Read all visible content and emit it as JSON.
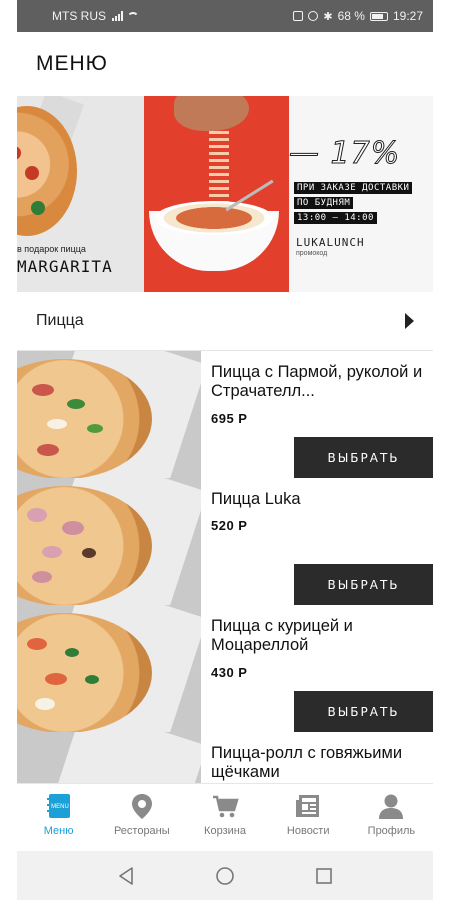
{
  "status_bar": {
    "carrier": "MTS RUS",
    "battery": "68 %",
    "time": "19:27"
  },
  "header": {
    "title": "МЕНЮ"
  },
  "banner": {
    "gift_text": "в подарок пицца",
    "gift_name": "MARGARITA",
    "discount": "— 17%",
    "lines": [
      "ПРИ ЗАКАЗЕ ДОСТАВКИ",
      "ПО БУДНЯМ",
      "13:00 — 14:00"
    ],
    "promo_code": "LUKALUNCH",
    "promo_label": "промокод"
  },
  "category": {
    "label": "Пицца"
  },
  "products": [
    {
      "name": "Пицца с Пармой, руколой и Страчателл...",
      "price": "695 Р",
      "button": "ВЫБРАТЬ"
    },
    {
      "name": "Пицца Luka",
      "price": "520 Р",
      "button": "ВЫБРАТЬ"
    },
    {
      "name": "Пицца с курицей и Моцареллой",
      "price": "430 Р",
      "button": "ВЫБРАТЬ"
    },
    {
      "name": "Пицца-ролл с говяжьими щёчками",
      "price": "",
      "button": ""
    }
  ],
  "tabs": [
    {
      "label": "Меню",
      "icon": "menu-book-icon",
      "active": true
    },
    {
      "label": "Рестораны",
      "icon": "location-pin-icon",
      "active": false
    },
    {
      "label": "Корзина",
      "icon": "cart-icon",
      "active": false
    },
    {
      "label": "Новости",
      "icon": "newspaper-icon",
      "active": false
    },
    {
      "label": "Профиль",
      "icon": "user-icon",
      "active": false
    }
  ],
  "tab_menu_badge": "MENU",
  "colors": {
    "accent": "#1ba0d8",
    "button": "#2b2b2b",
    "banner_red": "#e23f2c"
  }
}
